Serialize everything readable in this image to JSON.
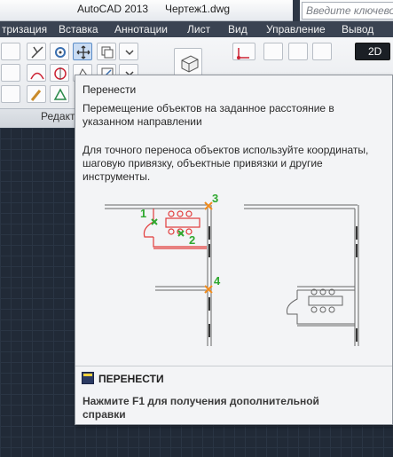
{
  "titlebar": {
    "app_name": "AutoCAD 2013",
    "file_name": "Чертеж1.dwg",
    "search_placeholder": "Введите ключевое слово"
  },
  "ribbon_tabs": [
    "тризация",
    "Вставка",
    "Аннотации",
    "Лист",
    "Вид",
    "Управление",
    "Вывод"
  ],
  "ribbon": {
    "panel_label": "Редакт",
    "right_button_label": "2D"
  },
  "tooltip": {
    "title": "Перенести",
    "description": "Перемещение объектов на заданное расстояние в указанном направлении",
    "body": "Для точного переноса объектов используйте координаты, шаговую привязку, объектные привязки и другие инструменты.",
    "illustration_labels": [
      "1",
      "2",
      "3",
      "4"
    ],
    "command_name": "ПЕРЕНЕСТИ",
    "help_text": "Нажмите F1 для получения дополнительной справки"
  },
  "colors": {
    "accent_green": "#2fa82f",
    "marker_orange": "#f08c1e",
    "selection_red": "#e23b3b"
  }
}
